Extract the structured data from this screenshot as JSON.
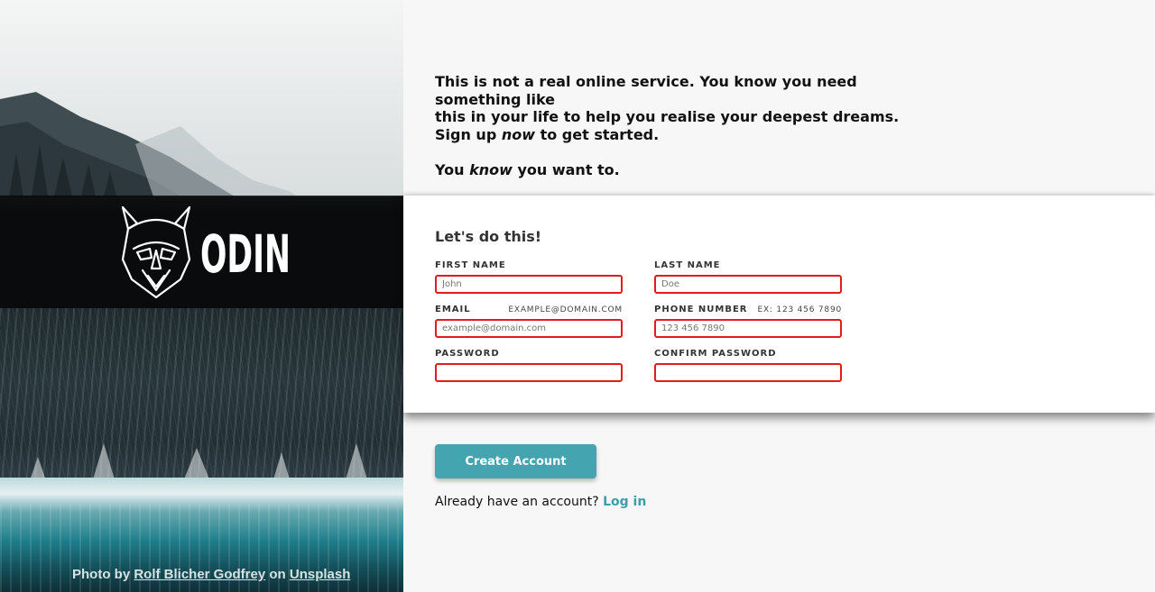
{
  "brand": {
    "name": "ODIN",
    "logo_icon": "viking-helmet-icon"
  },
  "intro": {
    "line1": "This is not a real online service. You know you need something like",
    "line2": "this in your life to help you realise your deepest dreams.",
    "line3_pre": "Sign up ",
    "line3_em": "now",
    "line3_post": " to get started.",
    "line4_pre": "You ",
    "line4_em": "know",
    "line4_post": " you want to."
  },
  "form": {
    "title": "Let's do this!",
    "first_name": {
      "label": "First Name",
      "placeholder": "John",
      "value": ""
    },
    "last_name": {
      "label": "Last Name",
      "placeholder": "Doe",
      "value": ""
    },
    "email": {
      "label": "Email",
      "hint": "example@domain.com",
      "placeholder": "example@domain.com",
      "value": ""
    },
    "phone": {
      "label": "Phone Number",
      "hint": "Ex: 123 456 7890",
      "placeholder": "123 456 7890",
      "value": ""
    },
    "password": {
      "label": "Password",
      "value": ""
    },
    "confirm_password": {
      "label": "Confirm Password",
      "value": ""
    },
    "error_border_color": "#e21b1b"
  },
  "actions": {
    "create_account": "Create Account",
    "login_prompt": "Already have an account?",
    "login_link": "Log in",
    "accent_color": "#44a4b0"
  },
  "credit": {
    "prefix": "Photo by ",
    "author": "Rolf Blicher Godfrey",
    "middle": " on ",
    "site": "Unsplash"
  }
}
